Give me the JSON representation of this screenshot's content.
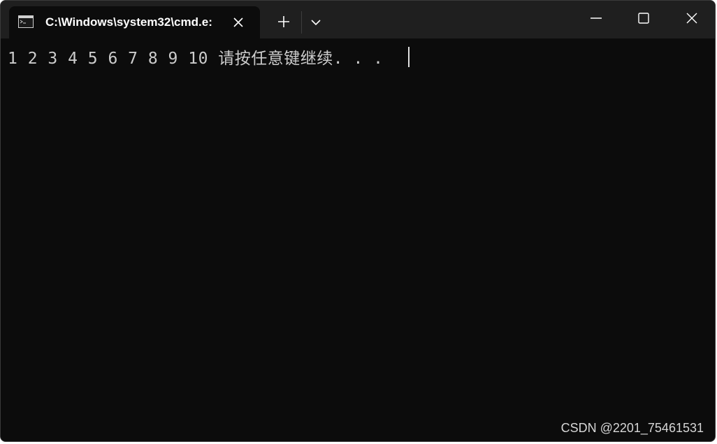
{
  "window": {
    "tab_title": "C:\\Windows\\system32\\cmd.e:",
    "icons": {
      "tab_icon": "cmd-icon",
      "tab_close": "close-icon",
      "new_tab": "plus-icon",
      "dropdown": "chevron-down-icon",
      "minimize": "minimize-icon",
      "maximize": "maximize-icon",
      "close": "close-icon"
    }
  },
  "console": {
    "output_line": "1 2 3 4 5 6 7 8 9 10 请按任意键继续. . ."
  },
  "watermark": {
    "text": "CSDN @2201_75461531"
  },
  "colors": {
    "titlebar_bg": "#1f1f1f",
    "console_bg": "#0c0c0c",
    "console_text": "#cccccc"
  }
}
